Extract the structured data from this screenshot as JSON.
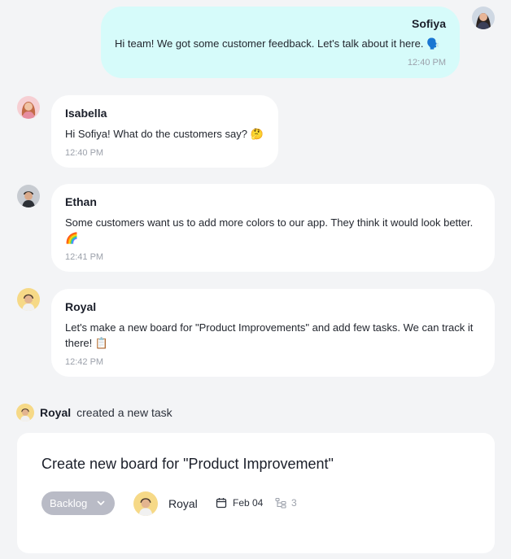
{
  "messages": [
    {
      "author": "Sofiya",
      "text": "Hi team! We got some customer feedback. Let's talk about it here. 🗣️",
      "time": "12:40 PM"
    },
    {
      "author": "Isabella",
      "text": "Hi Sofiya! What do the customers say? 🤔",
      "time": "12:40 PM"
    },
    {
      "author": "Ethan",
      "text": "Some customers want us to add more colors to our app. They think it would look better. 🌈",
      "time": "12:41 PM"
    },
    {
      "author": "Royal",
      "text": "Let's make a new board for \"Product Improvements\" and add few tasks. We can track it there! 📋",
      "time": "12:42 PM"
    }
  ],
  "activity": {
    "who": "Royal",
    "action": "created a new task"
  },
  "task": {
    "title": "Create new board for \"Product Improvement\"",
    "status": "Backlog",
    "assignee": "Royal",
    "due": "Feb 04",
    "subtasks": "3"
  },
  "icons": {
    "status_dropdown": "chevron-down-icon",
    "due": "calendar-icon",
    "subtasks": "subtask-icon"
  },
  "colors": {
    "own_bubble": "#d6fbfa",
    "other_bubble": "#ffffff",
    "background": "#f3f4f6",
    "status_pill": "#b9bbc6"
  }
}
